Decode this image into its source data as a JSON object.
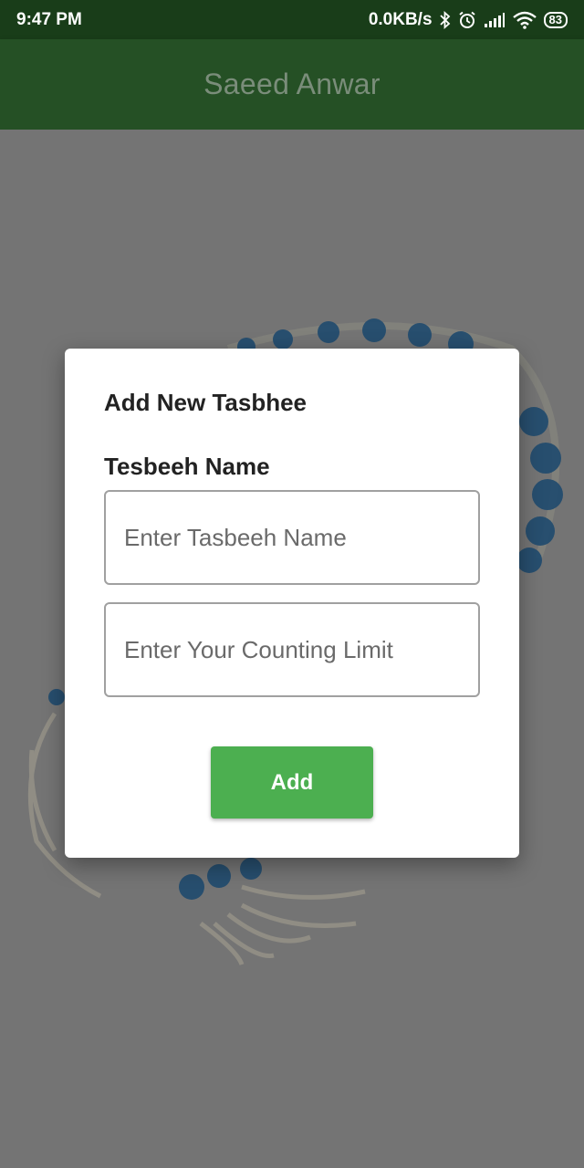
{
  "status_bar": {
    "time": "9:47 PM",
    "network_speed": "0.0KB/s",
    "battery_level": "83",
    "icons": [
      "bluetooth-icon",
      "alarm-icon",
      "signal-icon",
      "wifi-icon",
      "battery-icon"
    ]
  },
  "app_bar": {
    "title": "Saeed Anwar"
  },
  "dialog": {
    "title": "Add New Tasbhee",
    "field_label": "Tesbeeh Name",
    "name_input": {
      "placeholder": "Enter Tasbeeh Name",
      "value": ""
    },
    "limit_input": {
      "placeholder": "Enter Your Counting Limit",
      "value": ""
    },
    "add_label": "Add"
  },
  "colors": {
    "status_bar": "#193d19",
    "app_bar": "#255025",
    "accent": "#4caf50",
    "scrim": "#747474"
  }
}
